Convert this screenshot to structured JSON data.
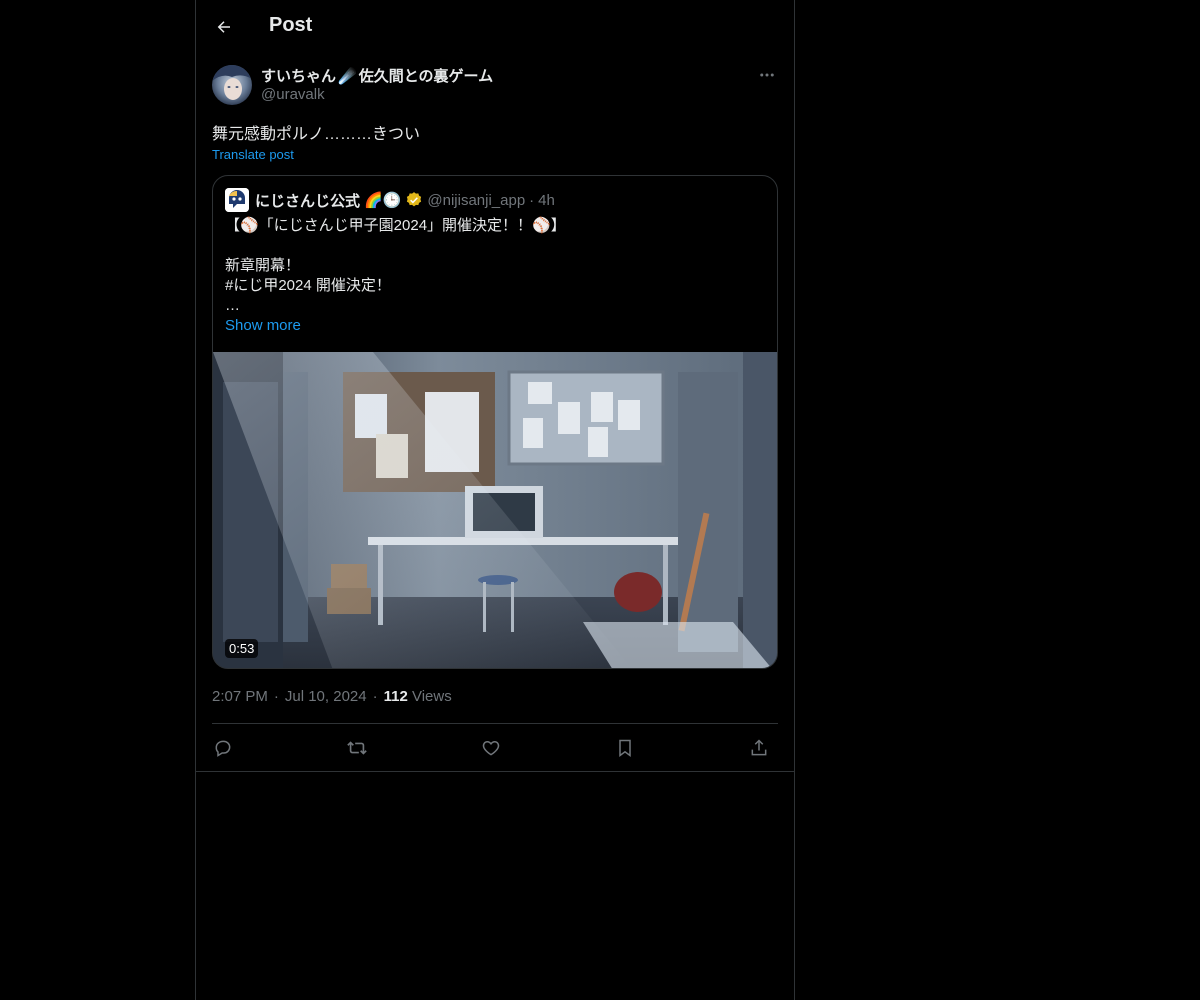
{
  "header": {
    "title": "Post",
    "back_icon": "arrow-left-icon"
  },
  "author": {
    "name": "すいちゃん☄️佐久間との裏ゲーム",
    "name_prefix": "すいちゃん",
    "name_emoji": "☄️",
    "name_suffix": "佐久間との裏ゲーム",
    "handle": "@uravalk",
    "more_icon": "more-dots-icon"
  },
  "post": {
    "text": "舞元感動ポルノ………きつい",
    "translate_label": "Translate post"
  },
  "quote": {
    "name": "にじさんじ公式",
    "name_emojis": "🌈🕒",
    "verified_icon": "verified-badge-icon",
    "handle": "@nijisanji_app",
    "separator": "·",
    "time": "4h",
    "lines": [
      "【⚾「にじさんじ甲子園2024」開催決定！！⚾】",
      "",
      "新章開幕！",
      "#にじ甲2024 開催決定！",
      "…"
    ],
    "show_more": "Show more",
    "video_duration": "0:53"
  },
  "meta": {
    "time": "2:07 PM",
    "separator": "·",
    "date": "Jul 10, 2024",
    "views_count": "112",
    "views_label": "Views"
  },
  "actions": {
    "reply_icon": "reply-icon",
    "repost_icon": "repost-icon",
    "like_icon": "like-icon",
    "bookmark_icon": "bookmark-icon",
    "share_icon": "share-icon"
  },
  "colors": {
    "background": "#000000",
    "text": "#e7e9ea",
    "secondary": "#71767b",
    "accent": "#1d9bf0",
    "border": "#2f3336"
  }
}
